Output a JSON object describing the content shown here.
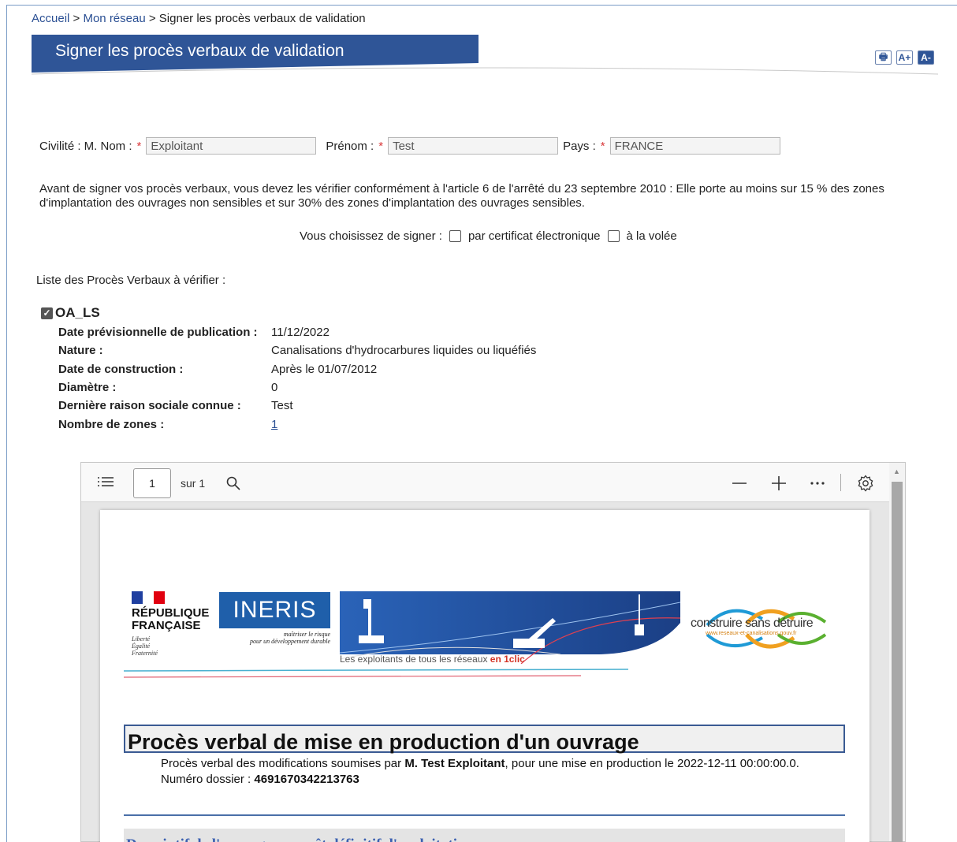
{
  "breadcrumb": {
    "home": "Accueil",
    "sep1": " > ",
    "network": "Mon réseau",
    "sep2": " > ",
    "current": "Signer les procès verbaux de validation"
  },
  "page_title": "Signer les procès verbaux de validation",
  "tools": {
    "print_icon": "🖶",
    "font_up": "A+",
    "font_down": "A-"
  },
  "identity": {
    "civilite_label": "Civilité : M. Nom :",
    "required_mark": "*",
    "nom_value": "Exploitant",
    "prenom_label": "Prénom :",
    "prenom_value": "Test",
    "pays_label": "Pays :",
    "pays_value": "FRANCE"
  },
  "notice": "Avant de signer vos procès verbaux, vous devez les vérifier conformément à l'article 6 de l'arrêté du 23 septembre 2010 : Elle porte au moins sur 15 % des zones d'implantation des ouvrages non sensibles et sur 30% des zones d'implantation des ouvrages sensibles.",
  "sign_choice": {
    "label": "Vous choisissez de signer :",
    "option1": "par certificat électronique",
    "option2": "à la volée"
  },
  "list_title": "Liste des Procès Verbaux à vérifier :",
  "pv": {
    "name": "OA_LS",
    "checked": true,
    "rows": [
      {
        "label": "Date prévisionnelle de publication :",
        "value": "11/12/2022"
      },
      {
        "label": "Nature :",
        "value": "Canalisations d'hydrocarbures liquides ou liquéfiés"
      },
      {
        "label": "Date de construction :",
        "value": "Après le 01/07/2012"
      },
      {
        "label": "Diamètre :",
        "value": "0"
      },
      {
        "label": "Dernière raison sociale connue :",
        "value": "Test"
      },
      {
        "label": "Nombre de zones :",
        "value": "1"
      }
    ]
  },
  "viewer": {
    "page_number": "1",
    "page_total": "sur 1",
    "icons": [
      "contents-icon",
      "search-icon",
      "zoom-out-icon",
      "zoom-in-icon",
      "more-icon",
      "settings-icon"
    ]
  },
  "document": {
    "rf_name_1": "RÉPUBLIQUE",
    "rf_name_2": "FRANÇAISE",
    "rf_motto_1": "Liberté",
    "rf_motto_2": "Égalité",
    "rf_motto_3": "Fraternité",
    "ineris": "INERIS",
    "ineris_tag_1": "maîtriser le risque",
    "ineris_tag_2": "pour un développement durable",
    "banner_text": "Les exploitants de tous les réseaux",
    "banner_text_em": "en 1clic",
    "csd_name": "construire sans détruire",
    "csd_url": "www.reseaux-et-canalisations.gouv.fr",
    "title": "Procès verbal de mise en production d'un ouvrage",
    "intro_prefix": "Procès verbal des modifications soumises par",
    "intro_person": "M.  Test  Exploitant",
    "intro_suffix": ", pour une mise en production le 2022-12-11 00:00:00.0.",
    "dossier_label": "Numéro dossier :",
    "dossier_value": "4691670342213763",
    "next_section": "Descriptif de l'ouvrage en arrêt définitif d'exploitation"
  },
  "colors": {
    "brand_blue": "#2f5597",
    "link": "#2a4f93",
    "required": "#d9383a"
  }
}
